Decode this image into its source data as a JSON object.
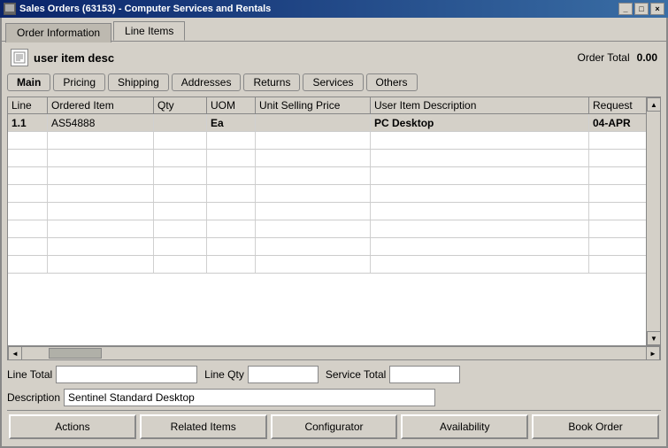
{
  "titleBar": {
    "title": "Sales Orders (63153) - Computer Services and Rentals",
    "controls": [
      "_",
      "□",
      "×"
    ]
  },
  "tabs": {
    "items": [
      {
        "label": "Order Information",
        "active": false
      },
      {
        "label": "Line Items",
        "active": true
      }
    ]
  },
  "header": {
    "icon": "≡",
    "userItemDesc": "user item desc",
    "orderTotalLabel": "Order Total",
    "orderTotalValue": "0.00"
  },
  "subTabs": {
    "items": [
      {
        "label": "Main",
        "active": true
      },
      {
        "label": "Pricing",
        "active": false
      },
      {
        "label": "Shipping",
        "active": false
      },
      {
        "label": "Addresses",
        "active": false
      },
      {
        "label": "Returns",
        "active": false
      },
      {
        "label": "Services",
        "active": false
      },
      {
        "label": "Others",
        "active": false
      }
    ]
  },
  "table": {
    "columns": [
      "Line",
      "Ordered Item",
      "Qty",
      "UOM",
      "Unit Selling Price",
      "User Item Description",
      "Request"
    ],
    "rows": [
      {
        "line": "1.1",
        "orderedItem": "AS54888",
        "qty": "",
        "uom": "Ea",
        "unitSellingPrice": "",
        "userItemDesc": "PC Desktop",
        "request": "04-APR",
        "selected": true
      },
      {
        "line": "",
        "orderedItem": "",
        "qty": "",
        "uom": "",
        "unitSellingPrice": "",
        "userItemDesc": "",
        "request": "",
        "selected": false
      },
      {
        "line": "",
        "orderedItem": "",
        "qty": "",
        "uom": "",
        "unitSellingPrice": "",
        "userItemDesc": "",
        "request": "",
        "selected": false
      },
      {
        "line": "",
        "orderedItem": "",
        "qty": "",
        "uom": "",
        "unitSellingPrice": "",
        "userItemDesc": "",
        "request": "",
        "selected": false
      },
      {
        "line": "",
        "orderedItem": "",
        "qty": "",
        "uom": "",
        "unitSellingPrice": "",
        "userItemDesc": "",
        "request": "",
        "selected": false
      },
      {
        "line": "",
        "orderedItem": "",
        "qty": "",
        "uom": "",
        "unitSellingPrice": "",
        "userItemDesc": "",
        "request": "",
        "selected": false
      },
      {
        "line": "",
        "orderedItem": "",
        "qty": "",
        "uom": "",
        "unitSellingPrice": "",
        "userItemDesc": "",
        "request": "",
        "selected": false
      },
      {
        "line": "",
        "orderedItem": "",
        "qty": "",
        "uom": "",
        "unitSellingPrice": "",
        "userItemDesc": "",
        "request": "",
        "selected": false
      },
      {
        "line": "",
        "orderedItem": "",
        "qty": "",
        "uom": "",
        "unitSellingPrice": "",
        "userItemDesc": "",
        "request": "",
        "selected": false
      }
    ]
  },
  "footer": {
    "lineTotalLabel": "Line Total",
    "lineTotalValue": "",
    "lineQtyLabel": "Line Qty",
    "lineQtyValue": "",
    "serviceTotalLabel": "Service Total",
    "serviceTotalValue": "",
    "descriptionLabel": "Description",
    "descriptionValue": "Sentinel Standard Desktop"
  },
  "buttons": [
    {
      "label": "Actions"
    },
    {
      "label": "Related Items"
    },
    {
      "label": "Configurator"
    },
    {
      "label": "Availability"
    },
    {
      "label": "Book Order"
    }
  ]
}
